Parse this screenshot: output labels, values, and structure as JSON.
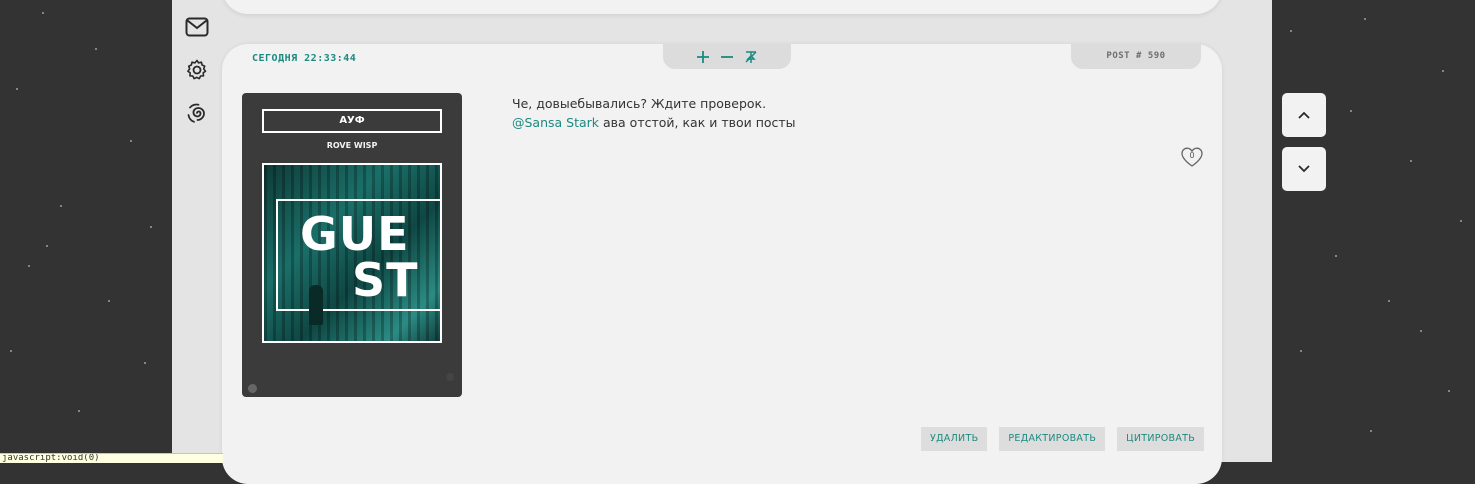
{
  "colors": {
    "background": "#333333",
    "column": "#e4e4e4",
    "card": "#f2f2f2",
    "accent": "#1b8a80",
    "profile_bg": "#3b3b3b"
  },
  "sidebar": {
    "icons": [
      "mail-icon",
      "gear-icon",
      "spiral-icon"
    ]
  },
  "post": {
    "date": "Сегодня 22:33:44",
    "number": "POST # 590",
    "controls": [
      "plus-icon",
      "minus-icon",
      "unpin-icon"
    ],
    "author": {
      "nick": "АУФ",
      "rank": "ROVE WISP",
      "avatar_line1": "GUE",
      "avatar_line2": "ST"
    },
    "message": {
      "line1": "Че, довыебывались? Ждите проверок.",
      "mention": "@Sansa Stark",
      "line2_rest": " ава отстой, как и твои посты"
    },
    "likes": "0",
    "actions": {
      "delete": "УДАЛИТЬ",
      "edit": "РЕДАКТИРОВАТЬ",
      "quote": "ЦИТИРОВАТЬ"
    }
  },
  "nav": {
    "up": "chevron-up-icon",
    "down": "chevron-down-icon"
  },
  "statusbar": {
    "text": "javascript:void(0)"
  }
}
